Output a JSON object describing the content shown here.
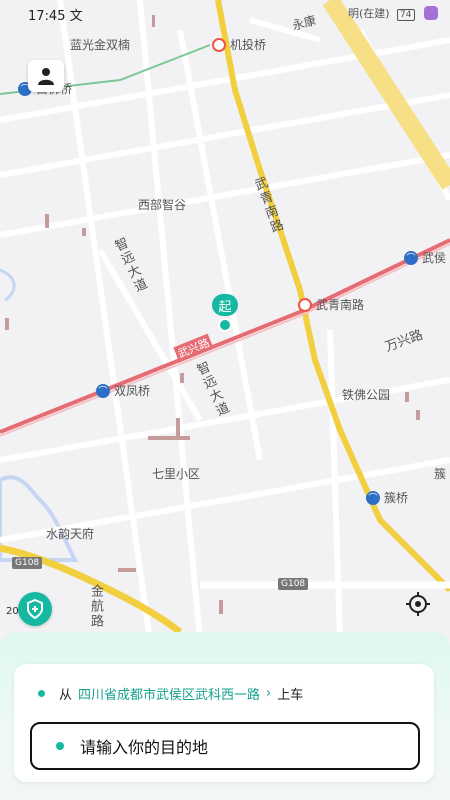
{
  "status_bar": {
    "time": "17:45",
    "time_suffix": "文",
    "right_text": "明(在建)",
    "battery": "74"
  },
  "map": {
    "places": {
      "lanpu": "蓝光金双楠",
      "jitou_qiao": "机投桥",
      "nibu": "西部智谷",
      "wuqing_nan": "武青南路",
      "zhiyuan": "智远大道",
      "wuxing": "武兴路",
      "wanxing": "万兴路",
      "tiefo": "铁佛公园",
      "qili": "七里小区",
      "shuiyun": "水韵天府",
      "jinhang": "金航路",
      "yongkang": "永康",
      "wuhou": "武侯",
      "cu": "簇"
    },
    "stations": {
      "left_top": "白佛桥",
      "wuqing_station": "武青南路",
      "shuangfeng": "双凤桥",
      "cuqiao": "簇桥",
      "wuhou_station": "武侯"
    },
    "road_shields": {
      "g108_left": "G108",
      "g108_right": "G108"
    },
    "scale_text": "200",
    "pin_label": "起"
  },
  "icons": {
    "user": "user-icon",
    "shield": "shield-plus-icon",
    "locate": "locate-icon",
    "metro": "metro-icon",
    "rail": "rail-station-icon"
  },
  "panel": {
    "from_prefix": "从",
    "from_address": "四川省成都市武侯区武科西一路",
    "from_suffix": "上车",
    "destination_placeholder": "请输入你的目的地"
  },
  "colors": {
    "accent": "#16b8a2",
    "major_road": "#f2cf3f",
    "arterial": "#e76b73"
  }
}
